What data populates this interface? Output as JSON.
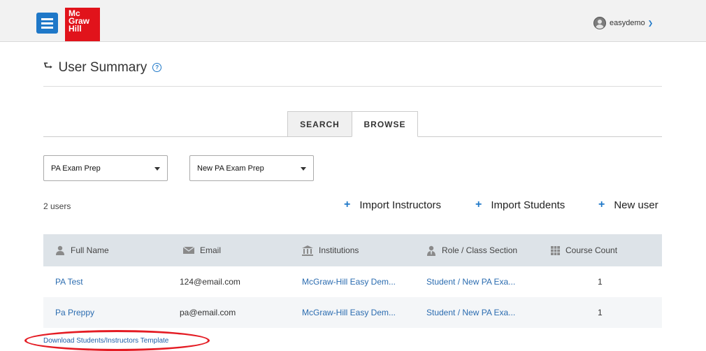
{
  "header": {
    "logo_lines": [
      "Mc",
      "Graw",
      "Hill"
    ],
    "username": "easydemo"
  },
  "page": {
    "title": "User Summary",
    "help_glyph": "?"
  },
  "tabs": [
    {
      "label": "SEARCH",
      "active": false
    },
    {
      "label": "BROWSE",
      "active": true
    }
  ],
  "filters": {
    "institution_select": "PA Exam Prep",
    "course_select": "New PA Exam Prep"
  },
  "summary": {
    "user_count": "2 users"
  },
  "actions": [
    {
      "label": "Import Instructors"
    },
    {
      "label": "Import Students"
    },
    {
      "label": "New user"
    }
  ],
  "table": {
    "columns": [
      {
        "label": "Full Name",
        "icon": "person-icon"
      },
      {
        "label": "Email",
        "icon": "envelope-icon"
      },
      {
        "label": "Institutions",
        "icon": "institution-icon"
      },
      {
        "label": "Role / Class Section",
        "icon": "role-icon"
      },
      {
        "label": "Course Count",
        "icon": "grid-icon"
      }
    ],
    "rows": [
      {
        "name": "PA Test",
        "email": "124@email.com",
        "institution": "McGraw-Hill Easy Dem...",
        "role": "Student / New PA Exa...",
        "course_count": "1"
      },
      {
        "name": "Pa Preppy",
        "email": "pa@email.com",
        "institution": "McGraw-Hill Easy Dem...",
        "role": "Student / New PA Exa...",
        "course_count": "1"
      }
    ]
  },
  "footer": {
    "download_link": "Download Students/Instructors Template"
  },
  "colors": {
    "brand_red": "#e1131b",
    "accent_blue": "#1f78c8",
    "highlight_ellipse": "#e41c24"
  }
}
